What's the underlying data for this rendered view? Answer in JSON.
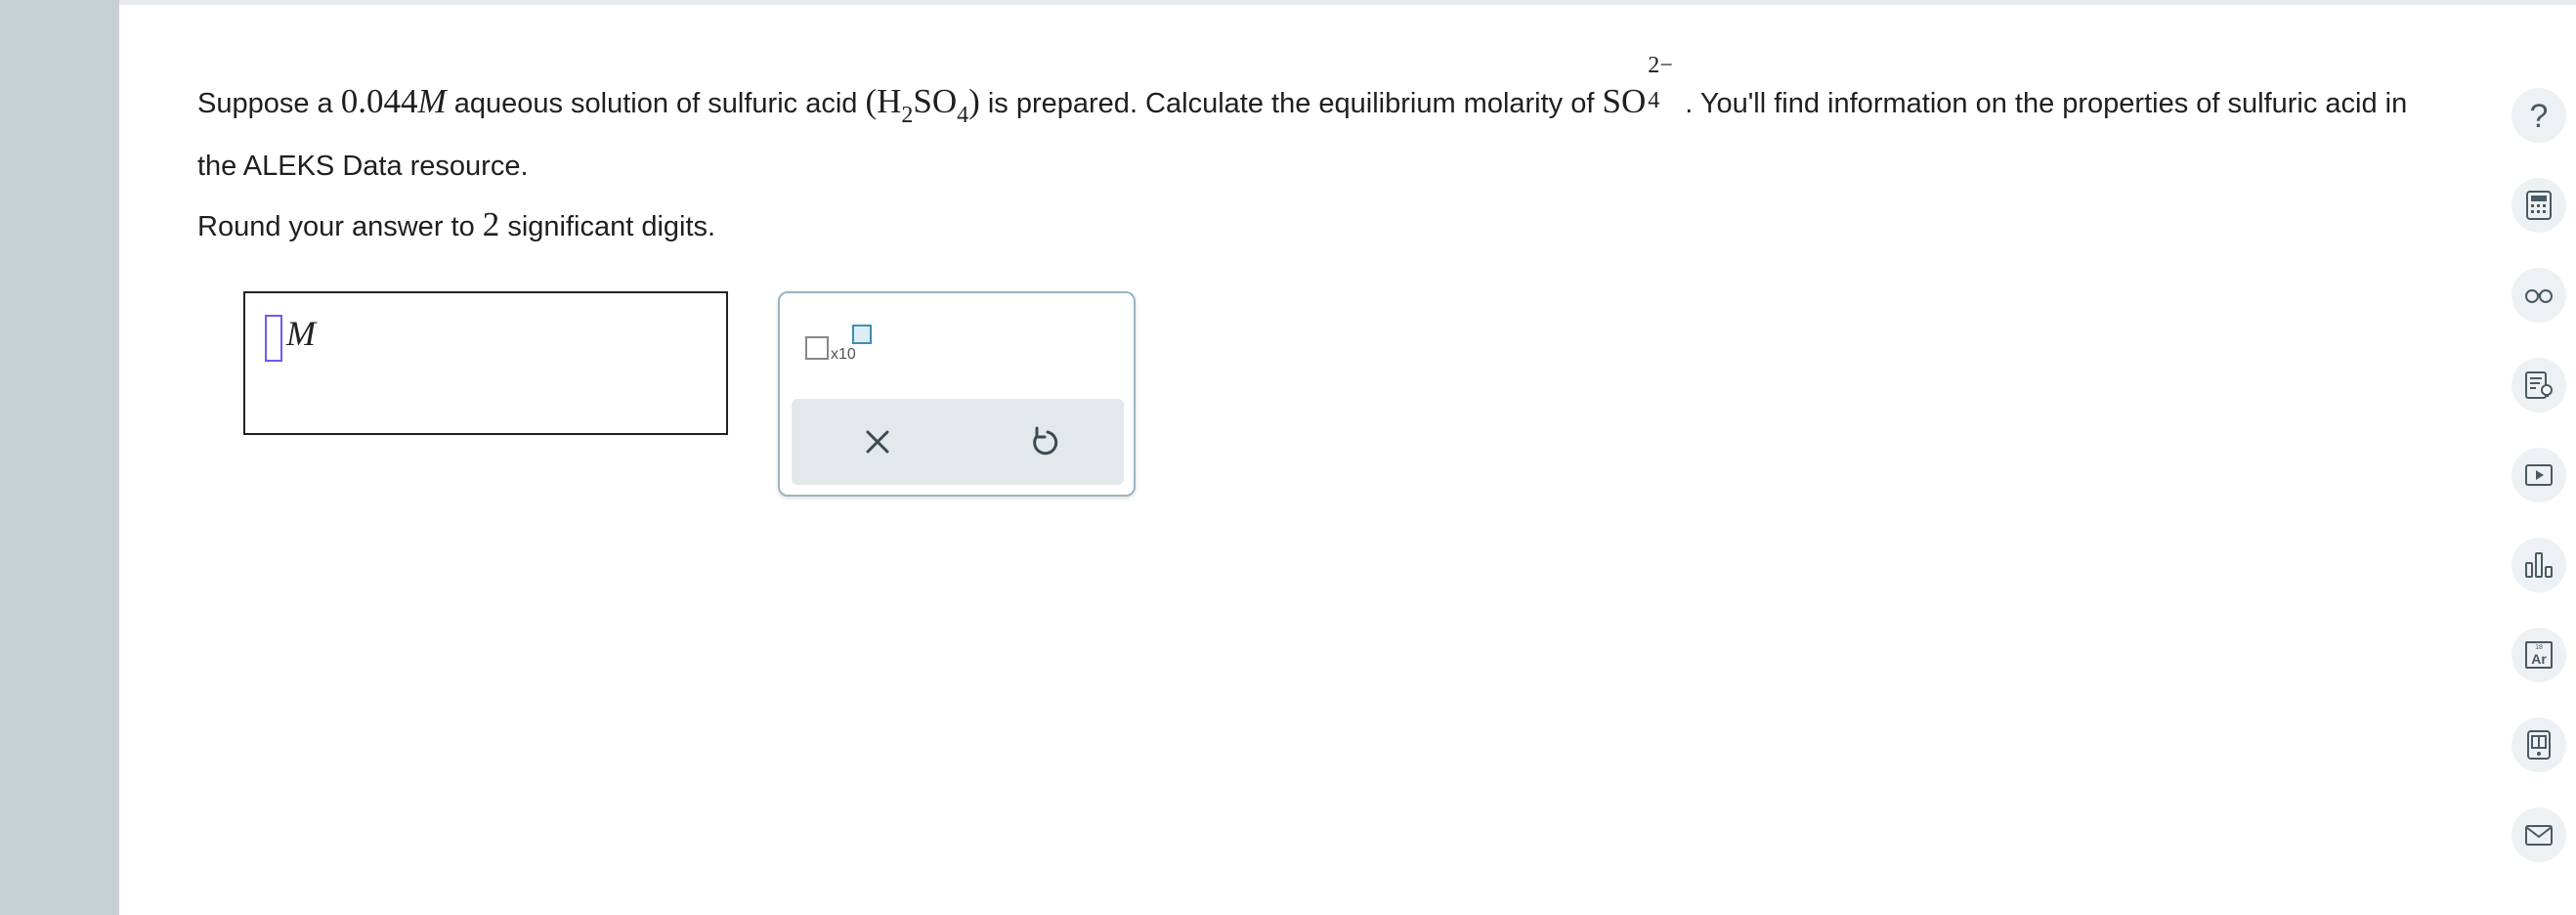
{
  "question": {
    "intro": "Suppose a ",
    "conc_value": "0.044",
    "conc_unit": "M",
    "after_conc": " aqueous solution of sulfuric acid ",
    "acid_open": "(H",
    "acid_sub1": "2",
    "acid_mid": "SO",
    "acid_sub2": "4",
    "acid_close": ")",
    "after_acid": " is prepared. Calculate the equilibrium molarity of ",
    "ion_base": "SO",
    "ion_sub": "4",
    "ion_charge": "2−",
    "after_ion": ". You'll find information on the properties of sulfuric acid in the ALEKS Data resource."
  },
  "rounding": {
    "before": "Round your answer to ",
    "digits": "2",
    "after": " significant digits."
  },
  "answer": {
    "unit": "M",
    "value": ""
  },
  "tool_panel": {
    "sci_notation_label": "x10"
  },
  "right_toolbar": {
    "help_label": "?"
  },
  "colors": {
    "left_rail": "#c7d0d5",
    "cursor": "#6a5cf0",
    "panel_border": "#9bb4c0",
    "action_bar": "#e3e8ea"
  }
}
